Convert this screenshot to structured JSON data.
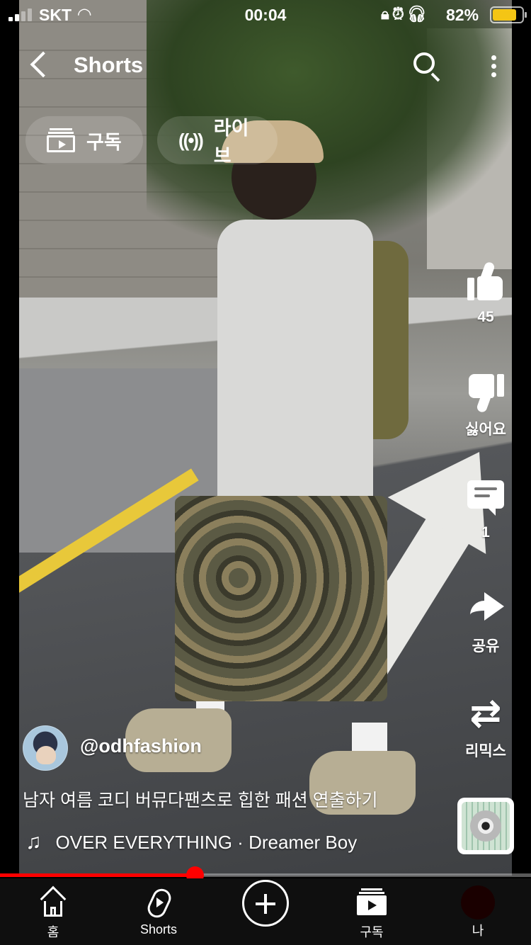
{
  "status_bar": {
    "carrier": "SKT",
    "time": "00:04",
    "battery_percent": "82%",
    "battery_level": 0.82,
    "icons": [
      "signal-icon",
      "wifi-icon",
      "orientation-lock-icon",
      "alarm-icon",
      "headphones-icon",
      "battery-icon"
    ]
  },
  "header": {
    "title": "Shorts",
    "back_icon": "chevron-left-icon",
    "search_icon": "search-icon",
    "more_icon": "more-vertical-icon"
  },
  "chips": [
    {
      "label": "구독",
      "icon": "subscriptions-icon"
    },
    {
      "label": "라이브",
      "icon": "live-icon"
    }
  ],
  "actions": {
    "like": {
      "label": "45",
      "icon": "thumbs-up-icon"
    },
    "dislike": {
      "label": "싫어요",
      "icon": "thumbs-down-icon"
    },
    "comment": {
      "label": "1",
      "icon": "comment-icon"
    },
    "share": {
      "label": "공유",
      "icon": "share-icon"
    },
    "remix": {
      "label": "리믹스",
      "icon": "remix-icon"
    }
  },
  "video": {
    "channel_handle": "@odhfashion",
    "caption": "남자 여름 코디 버뮤다팬츠로 힙한 패션 연출하기",
    "music": "OVER EVERYTHING · Dreamer Boy",
    "progress": 0.366
  },
  "bottom_nav": [
    {
      "label": "홈",
      "icon": "home-icon"
    },
    {
      "label": "Shorts",
      "icon": "shorts-icon"
    },
    {
      "label": "",
      "icon": "create-plus-icon"
    },
    {
      "label": "구독",
      "icon": "subscriptions-icon"
    },
    {
      "label": "나",
      "icon": "profile-avatar-icon"
    }
  ]
}
